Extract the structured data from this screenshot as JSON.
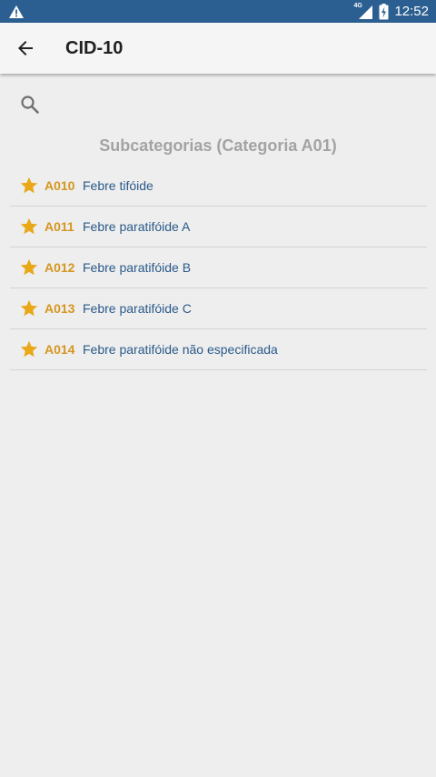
{
  "status_bar": {
    "time": "12:52",
    "network_label": "4G",
    "icons": [
      "warning-icon",
      "signal-icon",
      "battery-charging-icon"
    ]
  },
  "toolbar": {
    "title": "CID-10",
    "back_icon": "arrow-back-icon"
  },
  "search": {
    "icon": "search-icon",
    "placeholder": "",
    "value": ""
  },
  "section": {
    "title": "Subcategorias (Categoria A01)"
  },
  "items": [
    {
      "code": "A010",
      "label": "Febre tifóide",
      "icon": "star-icon"
    },
    {
      "code": "A011",
      "label": "Febre paratifóide A",
      "icon": "star-icon"
    },
    {
      "code": "A012",
      "label": "Febre paratifóide B",
      "icon": "star-icon"
    },
    {
      "code": "A013",
      "label": "Febre paratifóide C",
      "icon": "star-icon"
    },
    {
      "code": "A014",
      "label": "Febre paratifóide não especificada",
      "icon": "star-icon"
    }
  ],
  "colors": {
    "status_bar": "#2c5f91",
    "toolbar": "#f5f5f5",
    "background": "#eeeeee",
    "star": "#e8a818",
    "code": "#d5961f",
    "description": "#2a5a8a",
    "section_header": "#a3a3a3"
  }
}
